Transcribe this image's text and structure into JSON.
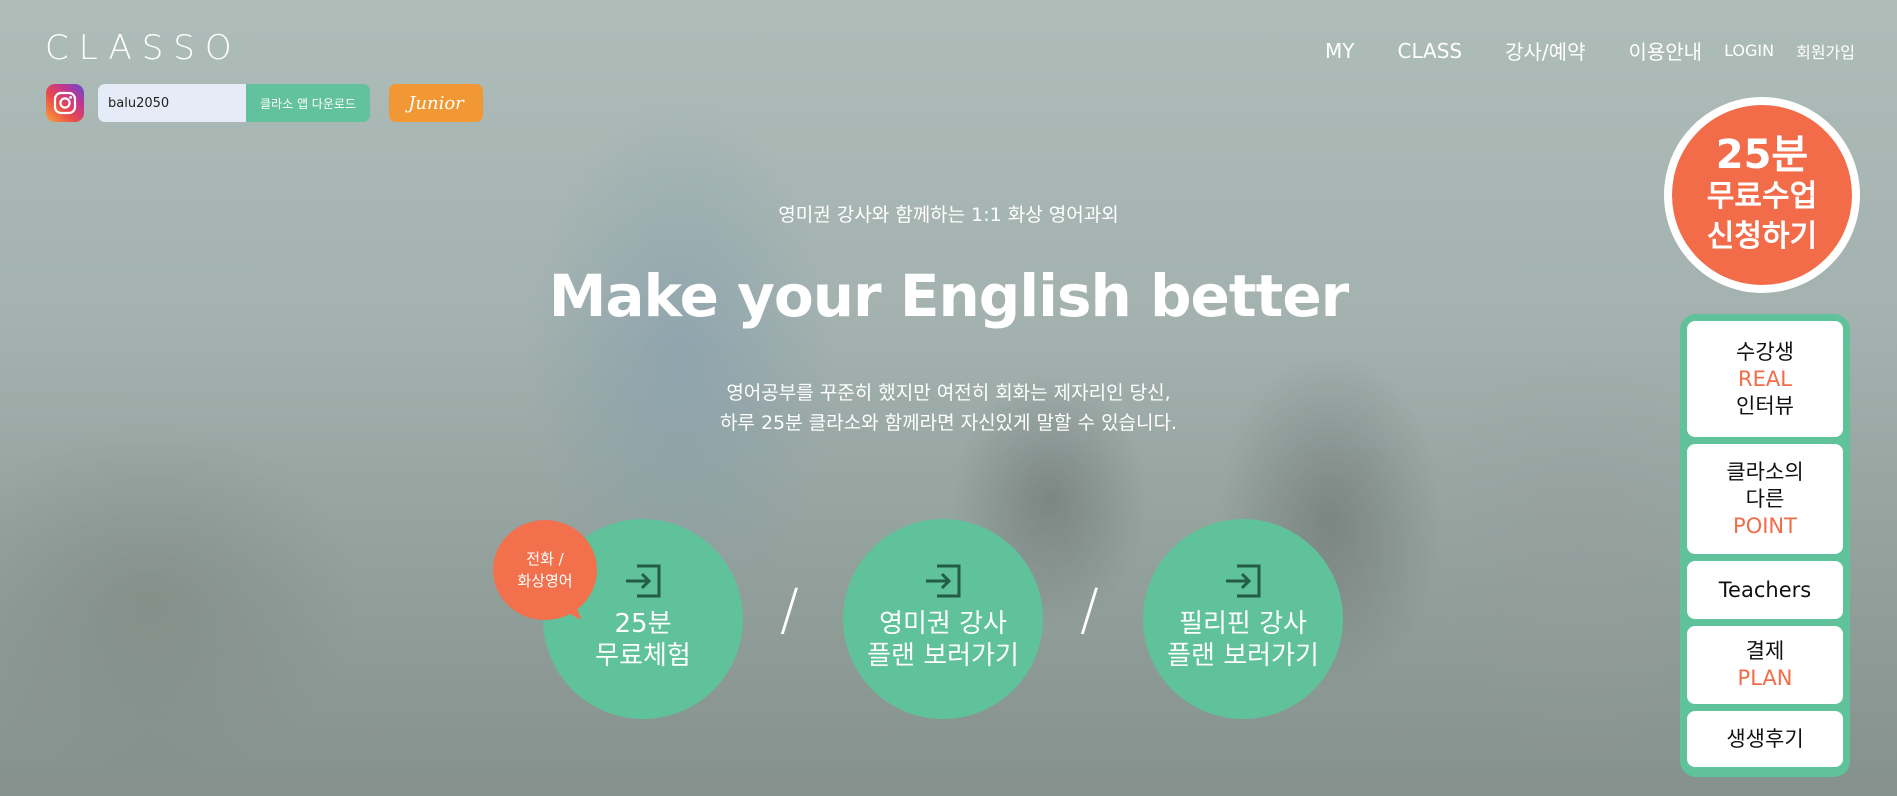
{
  "brand": {
    "logo": "CLASSO"
  },
  "colors": {
    "primary": "#5fc29a",
    "accent": "#f26c49",
    "junior": "#f19834"
  },
  "toolbar": {
    "search_value": "balu2050",
    "app_download_label": "클라소 앱 다운로드",
    "junior_label": "Junior"
  },
  "nav": {
    "items": [
      "MY",
      "CLASS",
      "강사/예약",
      "이용안내"
    ],
    "login": "LOGIN",
    "signup": "회원가입"
  },
  "hero": {
    "subtitle": "영미권 강사와 함께하는 1:1 화상 영어과외",
    "headline": "Make your English better",
    "desc_line1": "영어공부를 꾸준히 했지만 여전히 회화는 제자리인 당신,",
    "desc_line2": "하루 25분 클라소와 함께라면 자신있게 말할 수 있습니다."
  },
  "bubble": {
    "line1": "전화 /",
    "line2": "화상영어"
  },
  "circles": [
    {
      "line1": "25분",
      "line2": "무료체험"
    },
    {
      "line1": "영미권 강사",
      "line2": "플랜 보러가기"
    },
    {
      "line1": "필리핀 강사",
      "line2": "플랜 보러가기"
    }
  ],
  "free_trial": {
    "line1": "25분",
    "line2": "무료수업",
    "line3": "신청하기"
  },
  "side_menu": [
    {
      "line1": "수강생",
      "line2": "REAL",
      "line3": "인터뷰"
    },
    {
      "line1": "클라소의",
      "line2": "다른",
      "line3": "POINT"
    },
    {
      "line1": "Teachers"
    },
    {
      "line1": "결제",
      "line2": "PLAN"
    },
    {
      "line1": "생생후기"
    }
  ],
  "icons": [
    "instagram-icon",
    "enter-icon"
  ]
}
